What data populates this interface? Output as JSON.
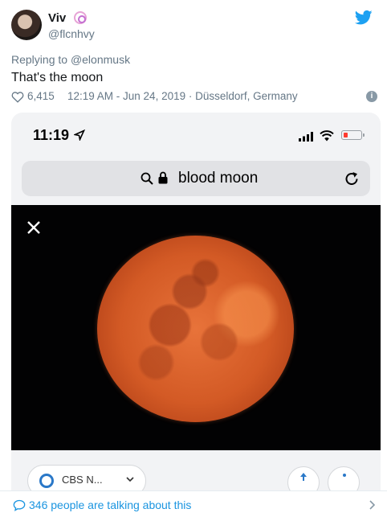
{
  "user": {
    "name": "Viv",
    "handle": "@flcnhvy",
    "badge_icon": "spiral-badge-icon"
  },
  "reply": {
    "prefix": "Replying to ",
    "mention": "@elonmusk"
  },
  "tweet": {
    "text": "That's the moon",
    "likes": "6,415",
    "timestamp": "12:19 AM - Jun 24, 2019 · Düsseldorf, Germany"
  },
  "phone": {
    "time": "11:19",
    "search_text": "blood moon"
  },
  "card": {
    "source_label": "CBS N..."
  },
  "footer": {
    "talking": "346 people are talking about this"
  },
  "colors": {
    "twitter_blue": "#1DA1F2",
    "link_blue": "#1B95E0",
    "moon_orange": "#E8733A",
    "battery_red": "#FF3B30"
  }
}
